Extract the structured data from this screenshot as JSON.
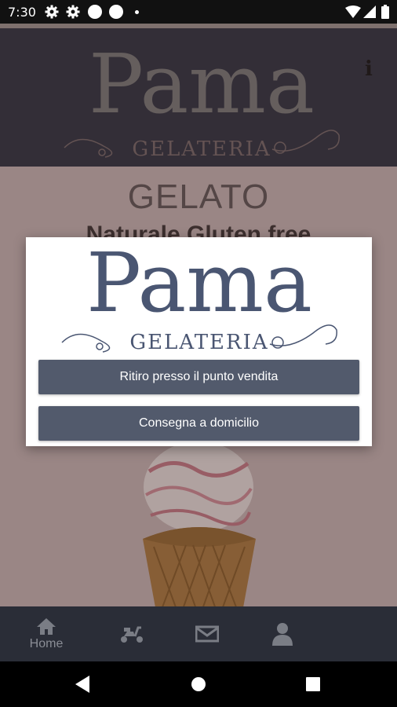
{
  "status_bar": {
    "time": "7:30",
    "icons": [
      "gear-icon",
      "gear-icon",
      "circle-icon",
      "circle-icon",
      "dot-icon",
      "wifi-icon",
      "signal-icon",
      "battery-icon"
    ]
  },
  "header": {
    "logo_text": "Pama",
    "logo_subtext": "GELATERIA",
    "info_label": "i"
  },
  "hero": {
    "title": "GELATO",
    "subtitle": "Naturale Gluten free"
  },
  "dialog": {
    "logo_text": "Pama",
    "logo_subtext": "GELATERIA",
    "pickup_label": "Ritiro presso il punto vendita",
    "delivery_label": "Consegna a domicilio"
  },
  "bottom_nav": {
    "items": [
      {
        "icon": "home-icon",
        "label": "Home"
      },
      {
        "icon": "scooter-icon",
        "label": ""
      },
      {
        "icon": "mail-icon",
        "label": ""
      },
      {
        "icon": "user-icon",
        "label": ""
      }
    ]
  },
  "colors": {
    "header_bg": "#2e3240",
    "page_bg": "#ccb9b7",
    "button_bg": "#525a6c",
    "logo_dark": "#4a5672",
    "logo_light": "#8a8886",
    "accent_rose": "#b07a78"
  }
}
